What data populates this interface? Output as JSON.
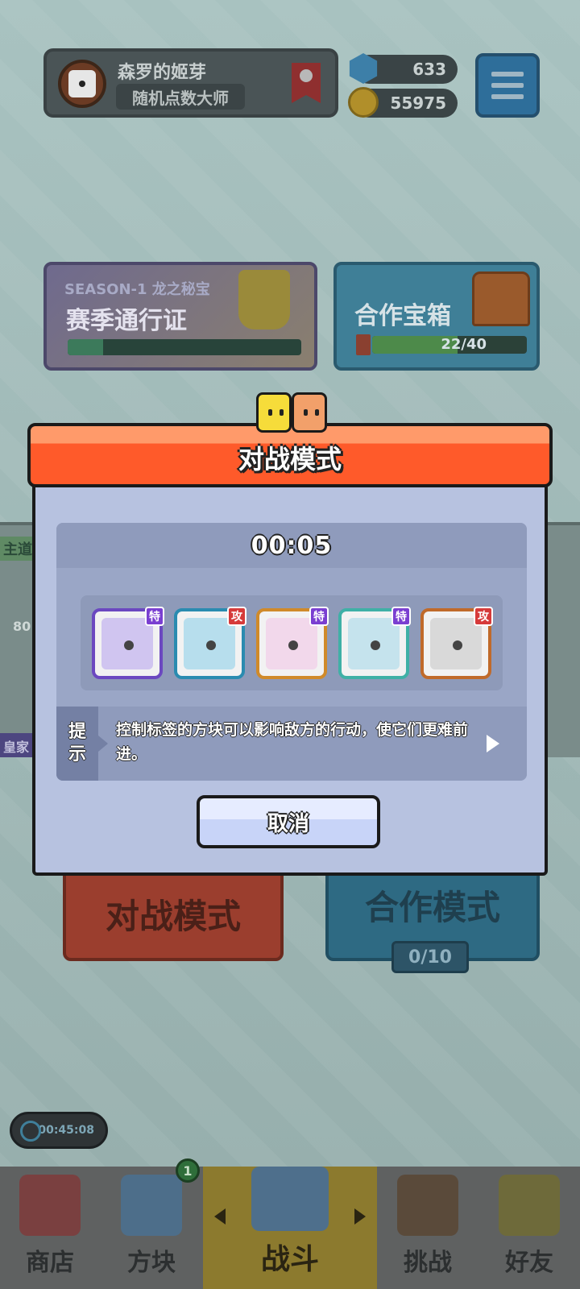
{
  "player": {
    "name": "森罗的姬芽",
    "title": "随机点数大师"
  },
  "currency": {
    "gems": "633",
    "coins": "55975"
  },
  "season": {
    "subtitle": "SEASON-1 龙之秘宝",
    "title": "赛季通行证",
    "progress_fraction": 0.15
  },
  "coop_chest": {
    "title": "合作宝箱",
    "progress_text": "22/40",
    "progress_fraction": 0.55
  },
  "side_panel": {
    "tag": "主道",
    "num": "80",
    "bottom": "皇家"
  },
  "modes": {
    "battle_label": "对战模式",
    "coop_label": "合作模式",
    "coop_count": "0/10"
  },
  "event_timer": "00:45:08",
  "bottom_nav": {
    "shop": "商店",
    "dice": "方块",
    "dice_badge": "1",
    "battle": "战斗",
    "challenge": "挑战",
    "friends": "好友"
  },
  "modal": {
    "title": "对战模式",
    "countdown": "00:05",
    "hint_label_1": "提",
    "hint_label_2": "示",
    "hint_text": "控制标签的方块可以影响敌方的行动，使它们更难前进。",
    "cancel_label": "取消",
    "deck": [
      {
        "tag": "特",
        "tag_color": "#7a3fd1",
        "border": "#6b48c0",
        "deco": "#b9a6ee"
      },
      {
        "tag": "攻",
        "tag_color": "#d63a3a",
        "border": "#2a8bb0",
        "deco": "#8fd0ea"
      },
      {
        "tag": "特",
        "tag_color": "#7a3fd1",
        "border": "#d08a2a",
        "deco": "#f2c6e6"
      },
      {
        "tag": "特",
        "tag_color": "#7a3fd1",
        "border": "#3fb0a6",
        "deco": "#a6d8ea"
      },
      {
        "tag": "攻",
        "tag_color": "#d63a3a",
        "border": "#c06a2a",
        "deco": "#c8c8c8"
      }
    ]
  }
}
